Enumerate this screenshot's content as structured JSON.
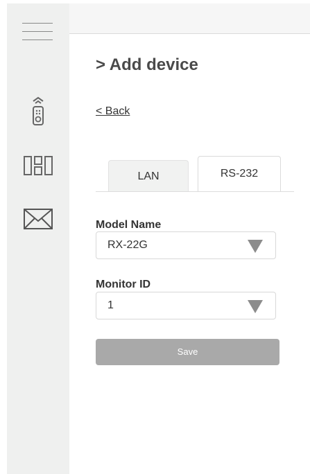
{
  "sidebar": {
    "items": [
      {
        "icon": "menu-icon"
      },
      {
        "icon": "remote-control-icon"
      },
      {
        "icon": "grid-layout-icon"
      },
      {
        "icon": "mail-icon"
      }
    ]
  },
  "header": {
    "title": "> Add device",
    "back_label": "< Back"
  },
  "tabs": [
    {
      "label": "LAN",
      "active": false
    },
    {
      "label": "RS-232",
      "active": true
    }
  ],
  "form": {
    "model_name": {
      "label": "Model Name",
      "value": "RX-22G"
    },
    "monitor_id": {
      "label": "Monitor ID",
      "value": "1"
    },
    "save_label": "Save"
  },
  "colors": {
    "sidebar_bg": "#eff0ef",
    "save_button_bg": "#a9a9a9",
    "caret": "#8c8c8c"
  }
}
